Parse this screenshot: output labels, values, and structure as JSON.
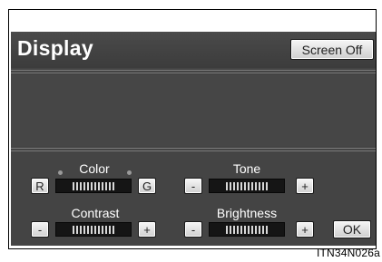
{
  "header": {
    "title": "Display",
    "screen_off_label": "Screen Off"
  },
  "controls": {
    "color": {
      "label": "Color",
      "left": "R",
      "right": "G"
    },
    "tone": {
      "label": "Tone",
      "minus": "-",
      "plus": "+"
    },
    "contrast": {
      "label": "Contrast",
      "minus": "-",
      "plus": "+"
    },
    "brightness": {
      "label": "Brightness",
      "minus": "-",
      "plus": "+"
    },
    "ok_label": "OK"
  },
  "caption": "ITN34N026a",
  "colors": {
    "panel": "#444444",
    "button": "#e8e8e8",
    "text": "#ffffff"
  }
}
